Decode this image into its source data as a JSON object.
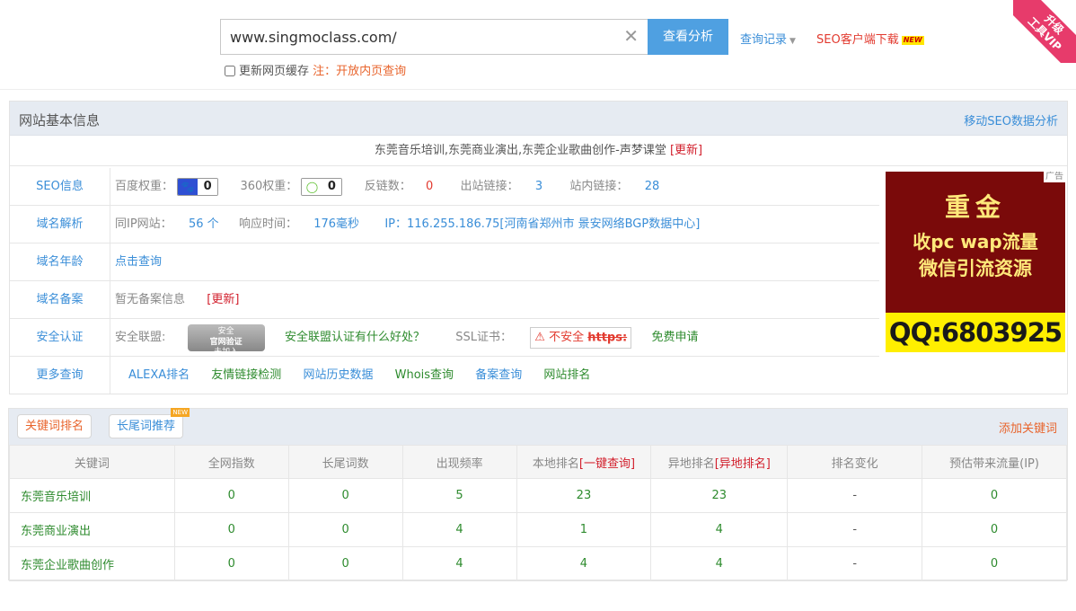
{
  "search": {
    "value": "www.singmoclass.com/",
    "button": "查看分析",
    "history": "查询记录",
    "client_download": "SEO客户端下载",
    "new_badge": "NEW",
    "cache_label": "更新网页缓存",
    "cache_note": "注：开放内页查询"
  },
  "vip_ribbon": {
    "line1": "升级",
    "line2": "工具VIP"
  },
  "basic": {
    "title": "网站基本信息",
    "mobile_link": "移动SEO数据分析",
    "site_title": "东莞音乐培训,东莞商业演出,东莞企业歌曲创作-声梦课堂",
    "update": "[更新]",
    "seo": {
      "label": "SEO信息",
      "baidu_label": "百度权重：",
      "baidu_value": "0",
      "s360_label": "360权重：",
      "s360_value": "0",
      "backlinks_label": "反链数：",
      "backlinks_value": "0",
      "outlinks_label": "出站链接：",
      "outlinks_value": "3",
      "inlinks_label": "站内链接：",
      "inlinks_value": "28"
    },
    "domain": {
      "label": "域名解析",
      "sameip_label": "同IP网站：",
      "sameip_value": "56 个",
      "resp_label": "响应时间：",
      "resp_value": "176毫秒",
      "ip_text": "IP：116.255.186.75[河南省郑州市 景安网络BGP数据中心]"
    },
    "age": {
      "label": "域名年龄",
      "link": "点击查询"
    },
    "icp": {
      "label": "域名备案",
      "text": "暂无备案信息",
      "update": "[更新]"
    },
    "security": {
      "label": "安全认证",
      "alliance_label": "安全联盟:",
      "badge_top": "安全",
      "badge_mid": "官网验证",
      "badge_bot": "未加入",
      "alliance_link": "安全联盟认证有什么好处？",
      "ssl_label": "SSL证书：",
      "ssl_status": "不安全",
      "ssl_https": "https:",
      "ssl_apply": "免费申请"
    },
    "more": {
      "label": "更多查询",
      "links": [
        "ALEXA排名",
        "友情链接检测",
        "网站历史数据",
        "Whois查询",
        "备案查询",
        "网站排名"
      ]
    }
  },
  "ad": {
    "tag": "广告",
    "line1": "重金",
    "line2": "收pc wap流量",
    "line3": "微信引流资源",
    "qq": "QQ:6803925"
  },
  "keywords": {
    "tab_active": "关键词排名",
    "tab_second": "长尾词推荐",
    "tab_new": "NEW",
    "add_link": "添加关键词",
    "headers": {
      "keyword": "关键词",
      "index": "全网指数",
      "longtail": "长尾词数",
      "freq": "出现频率",
      "local": "本地排名",
      "local_link": "[一键查询]",
      "remote": "异地排名",
      "remote_link": "[异地排名]",
      "change": "排名变化",
      "traffic": "预估带来流量(IP)"
    },
    "rows": [
      {
        "keyword": "东莞音乐培训",
        "index": "0",
        "longtail": "0",
        "freq": "5",
        "local": "23",
        "remote": "23",
        "change": "-",
        "traffic": "0"
      },
      {
        "keyword": "东莞商业演出",
        "index": "0",
        "longtail": "0",
        "freq": "4",
        "local": "1",
        "remote": "4",
        "change": "-",
        "traffic": "0"
      },
      {
        "keyword": "东莞企业歌曲创作",
        "index": "0",
        "longtail": "0",
        "freq": "4",
        "local": "4",
        "remote": "4",
        "change": "-",
        "traffic": "0"
      }
    ]
  }
}
